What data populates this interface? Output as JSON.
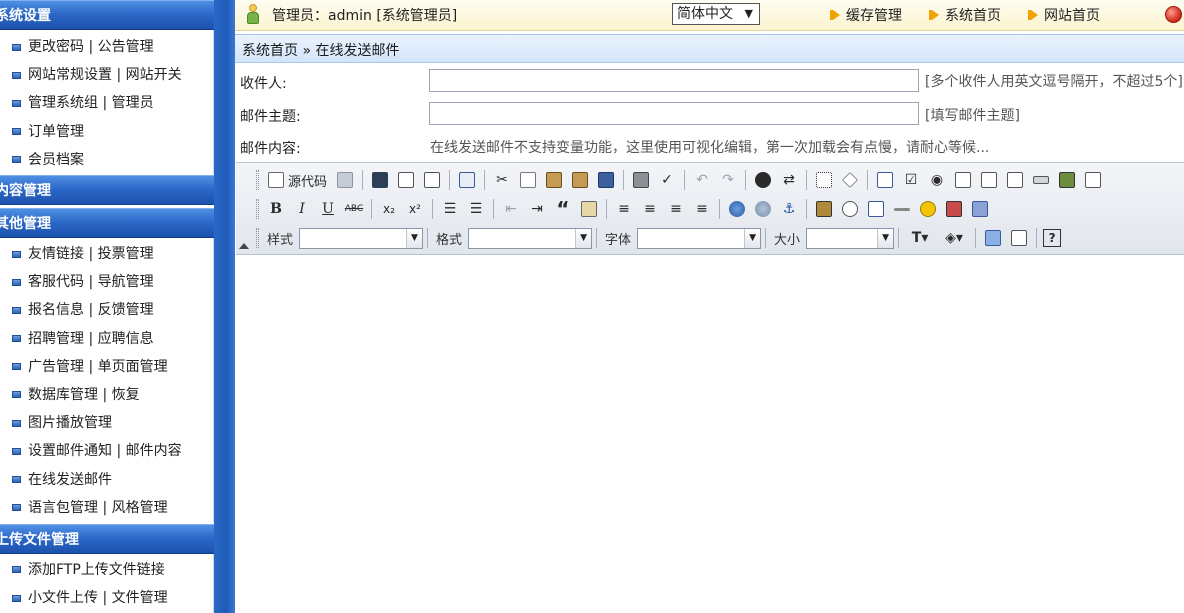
{
  "sidebar": {
    "sections": [
      {
        "title": "系统设置",
        "items": [
          "更改密码 | 公告管理",
          "网站常规设置 | 网站开关",
          "管理系统组 | 管理员",
          "订单管理",
          "会员档案"
        ]
      },
      {
        "title": "内容管理",
        "items": []
      },
      {
        "title": "其他管理",
        "items": [
          "友情链接 | 投票管理",
          "客服代码 | 导航管理",
          "报名信息 | 反馈管理",
          "招聘管理 | 应聘信息",
          "广告管理 | 单页面管理",
          "数据库管理 | 恢复",
          "图片播放管理",
          "设置邮件通知 | 邮件内容",
          "在线发送邮件",
          "语言包管理 | 风格管理"
        ]
      },
      {
        "title": "上传文件管理",
        "items": [
          "添加FTP上传文件链接",
          "小文件上传 | 文件管理"
        ]
      }
    ]
  },
  "topbar": {
    "admin_label": "管理员：admin [系统管理员]",
    "language": "简体中文",
    "links": [
      "缓存管理",
      "系统首页",
      "网站首页"
    ]
  },
  "breadcrumb": "系统首页 » 在线发送邮件",
  "form": {
    "recipient_label": "收件人:",
    "recipient_value": "",
    "recipient_hint": "[多个收件人用英文逗号隔开，不超过5个]",
    "subject_label": "邮件主题:",
    "subject_value": "",
    "subject_hint": "[填写邮件主题]",
    "content_label": "邮件内容:",
    "content_note": "在线发送邮件不支持变量功能，这里使用可视化编辑，第一次加载会有点慢，请耐心等候..."
  },
  "editor": {
    "source_label": "源代码",
    "style_label": "样式",
    "format_label": "格式",
    "font_label": "字体",
    "size_label": "大小",
    "bold": "B",
    "italic": "I",
    "underline": "U",
    "strike": "ABC",
    "subscript": "x₂",
    "superscript": "x²",
    "quote": "“",
    "help": "?"
  },
  "colors": {
    "sidebar_header": "#2a66c6",
    "topbar_bg": "#fbf3cf",
    "breadcrumb_bg": "#d3e5fa",
    "accent_arrow": "#f0a300"
  }
}
